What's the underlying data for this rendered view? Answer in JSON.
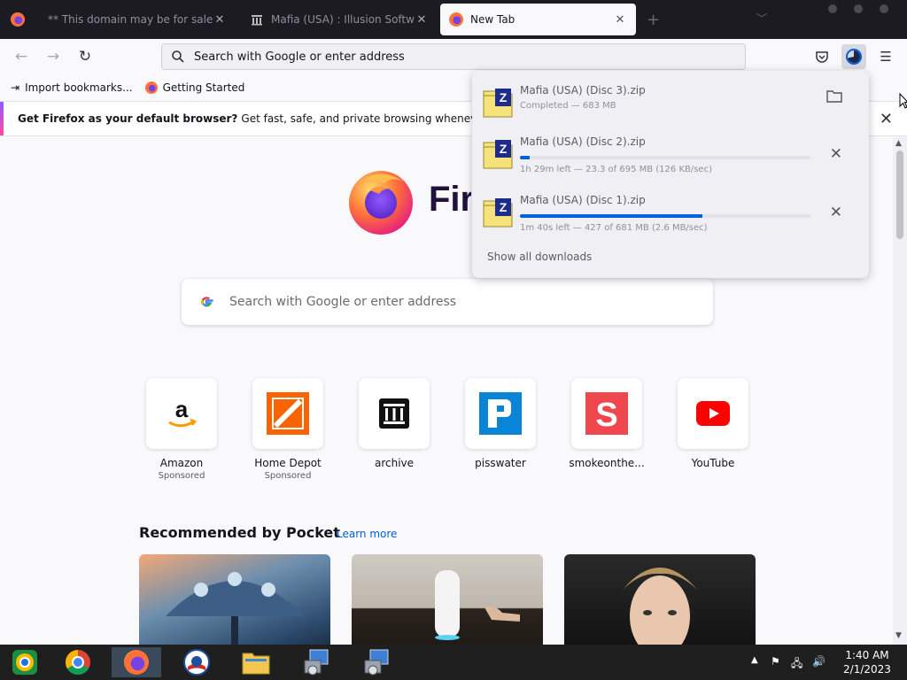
{
  "tabs": [
    {
      "title": "** This domain may be for sale **",
      "active": false
    },
    {
      "title": "Mafia (USA) : Illusion Software",
      "active": false
    },
    {
      "title": "New Tab",
      "active": true
    }
  ],
  "navbar": {
    "url_placeholder": "Search with Google or enter address"
  },
  "bookmarks": [
    {
      "label": "Import bookmarks..."
    },
    {
      "label": "Getting Started"
    }
  ],
  "notification": {
    "bold": "Get Firefox as your default browser?",
    "text": "Get fast, safe, and private browsing whenever you use the w"
  },
  "newtab": {
    "wordmark": "Firefox",
    "search_placeholder": "Search with Google or enter address",
    "tiles": [
      {
        "name": "Amazon",
        "sub": "Sponsored",
        "icon": "amazon-icon"
      },
      {
        "name": "Home Depot",
        "sub": "Sponsored",
        "icon": "home-depot-icon"
      },
      {
        "name": "archive",
        "sub": "",
        "icon": "archive-icon"
      },
      {
        "name": "pisswater",
        "sub": "",
        "icon": "pisswater-icon"
      },
      {
        "name": "smokeonthe...",
        "sub": "",
        "icon": "smokeonthe-icon"
      },
      {
        "name": "YouTube",
        "sub": "",
        "icon": "youtube-icon"
      }
    ],
    "pocket": {
      "heading": "Recommended by Pocket",
      "learn_more": "Learn more"
    }
  },
  "downloads": {
    "items": [
      {
        "name": "Mafia (USA) (Disc 3).zip",
        "status": "Completed — 683 MB",
        "progress": null,
        "action": "folder-icon"
      },
      {
        "name": "Mafia (USA) (Disc 2).zip",
        "status": "1h 29m left — 23.3 of 695 MB (126 KB/sec)",
        "progress": 0.034,
        "action": "cancel-icon"
      },
      {
        "name": "Mafia (USA) (Disc 1).zip",
        "status": "1m 40s left — 427 of 681 MB (2.6 MB/sec)",
        "progress": 0.627,
        "action": "cancel-icon"
      }
    ],
    "show_all": "Show all downloads"
  },
  "taskbar": {
    "time": "1:40 AM",
    "date": "2/1/2023"
  }
}
